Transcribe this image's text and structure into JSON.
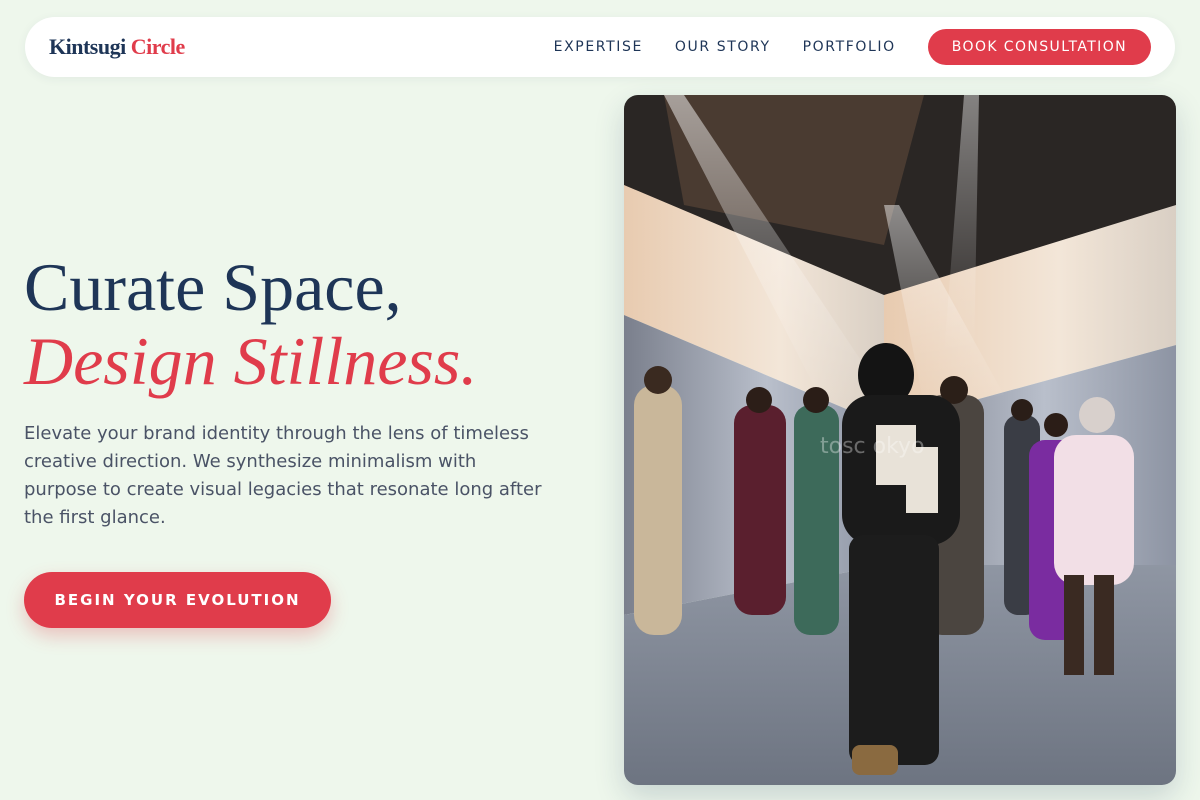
{
  "brand": {
    "name_part1": "Kintsugi",
    "name_part2": "Circle"
  },
  "nav": {
    "links": [
      "EXPERTISE",
      "OUR STORY",
      "PORTFOLIO"
    ],
    "cta_label": "BOOK CONSULTATION"
  },
  "hero": {
    "headline_line1": "Curate Space,",
    "headline_line2": "Design Stillness.",
    "description": "Elevate your brand identity through the lens of timeless creative direction. We synthesize minimalism with purpose to create visual legacies that resonate long after the first glance.",
    "primary_button_label": "BEGIN YOUR EVOLUTION",
    "image_watermark": "tosc  okyo"
  },
  "colors": {
    "accent": "#e03c4b",
    "navy": "#1e3557",
    "background": "#eef7ec"
  }
}
